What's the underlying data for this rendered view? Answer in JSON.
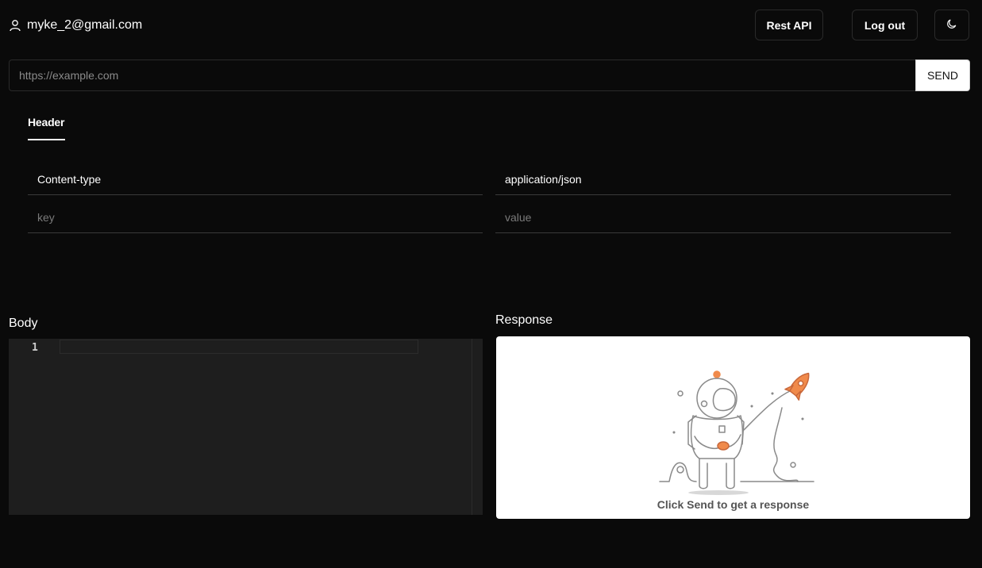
{
  "header": {
    "user_email": "myke_2@gmail.com",
    "user_icon": "user-icon",
    "rest_api_label": "Rest API",
    "logout_label": "Log out",
    "theme_icon": "moon-icon"
  },
  "request": {
    "url_placeholder": "https://example.com",
    "url_value": "",
    "send_label": "SEND"
  },
  "tabs": [
    {
      "label": "Header",
      "active": true
    }
  ],
  "headers": {
    "rows": [
      {
        "key": "Content-type",
        "value": "application/json"
      },
      {
        "key": "",
        "value": ""
      }
    ],
    "key_placeholder": "key",
    "value_placeholder": "value"
  },
  "body": {
    "label": "Body",
    "line_numbers": [
      "1"
    ],
    "content": ""
  },
  "response": {
    "label": "Response",
    "empty_message": "Click Send to get a response",
    "illustration_icon": "astronaut-rocket-illustration"
  },
  "colors": {
    "background": "#0a0a0a",
    "editor_bg": "#1e1e1e",
    "accent": "#f08a4b",
    "text": "#ffffff"
  }
}
